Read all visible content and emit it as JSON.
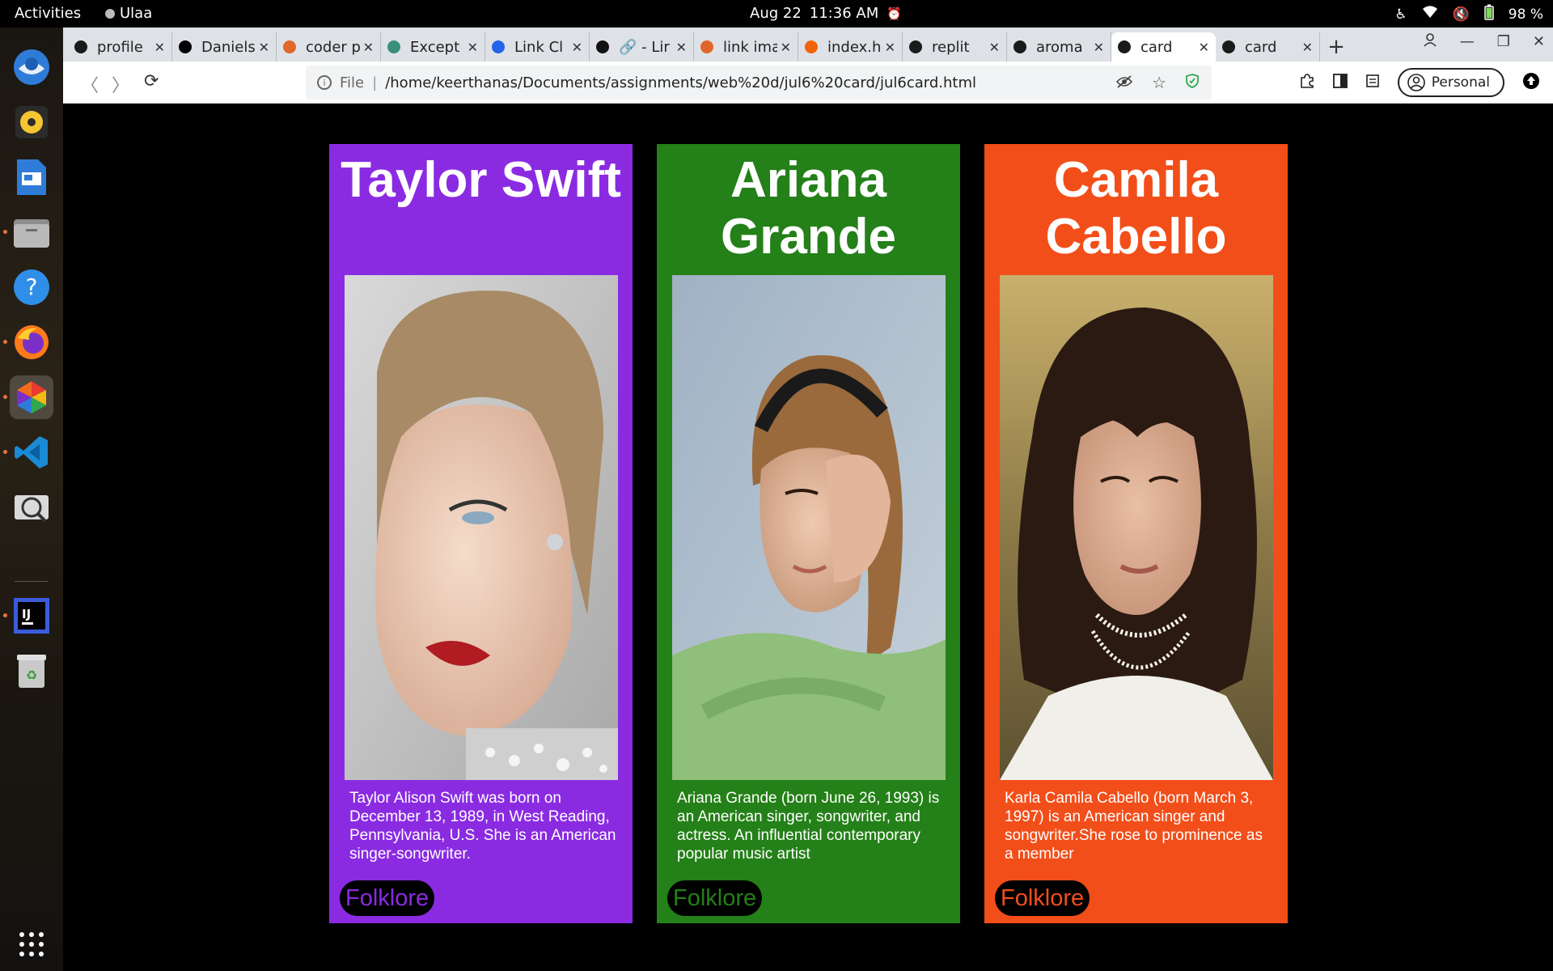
{
  "system_bar": {
    "activities": "Activities",
    "app_name": "Ulaa",
    "date": "Aug 22",
    "time": "11:36 AM",
    "battery": "98 %"
  },
  "tabs": [
    {
      "label": "profile",
      "favicon_color": "#1b1b1b"
    },
    {
      "label": "Daniels",
      "favicon_color": "#000000"
    },
    {
      "label": "coder p",
      "favicon_color": "#e0662a"
    },
    {
      "label": "Except",
      "favicon_color": "#3a8f7a"
    },
    {
      "label": "Link Cl",
      "favicon_color": "#2563eb"
    },
    {
      "label": "🔗 - Lir",
      "favicon_color": "#111111"
    },
    {
      "label": "link ima",
      "favicon_color": "#e0662a"
    },
    {
      "label": "index.h",
      "favicon_color": "#f26207"
    },
    {
      "label": "replit",
      "favicon_color": "#1b1b1b"
    },
    {
      "label": "aroma",
      "favicon_color": "#1b1b1b"
    },
    {
      "label": "card",
      "favicon_color": "#1b1b1b",
      "active": true
    },
    {
      "label": "card",
      "favicon_color": "#1b1b1b"
    }
  ],
  "address_bar": {
    "scheme": "File",
    "url": "/home/keerthanas/Documents/assignments/web%20d/jul6%20card/jul6card.html"
  },
  "profile_label": "Personal",
  "cards": [
    {
      "name": "Taylor Swift",
      "bio": "Taylor Alison Swift was born on December 13, 1989, in West Reading, Pennsylvania, U.S. She is an American singer-songwriter.",
      "button": "Folklore",
      "bg_color": "#8a2be2",
      "button_text_color": "#8a2be2"
    },
    {
      "name": "Ariana Grande",
      "bio": "Ariana Grande (born June 26, 1993) is an American singer, songwriter, and actress. An influential contemporary popular music artist",
      "button": "Folklore",
      "bg_color": "#248018",
      "button_text_color": "#248018"
    },
    {
      "name": "Camila Cabello",
      "bio": "Karla Camila Cabello (born March 3, 1997) is an American singer and songwriter.She rose to prominence as a member",
      "button": "Folklore",
      "bg_color": "#f24e1a",
      "button_text_color": "#f24e1a"
    }
  ]
}
